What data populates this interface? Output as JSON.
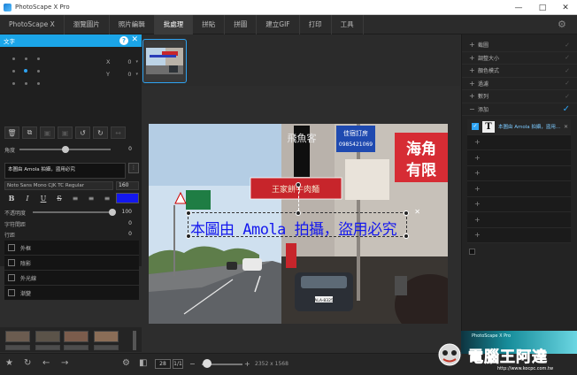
{
  "window": {
    "title": "PhotoScape X Pro"
  },
  "menu": [
    {
      "label": "PhotoScape X"
    },
    {
      "label": "瀏覽圖片"
    },
    {
      "label": "照片編輯"
    },
    {
      "label": "批處理"
    },
    {
      "label": "拼貼"
    },
    {
      "label": "拼圖"
    },
    {
      "label": "建立GIF"
    },
    {
      "label": "打印"
    },
    {
      "label": "工具"
    }
  ],
  "active_menu": "批處理",
  "left_panel": {
    "title": "文字",
    "x_label": "X",
    "x_value": "0",
    "y_label": "Y",
    "y_value": "0",
    "angle_label": "角度",
    "angle_value": "0",
    "angle_fraction": 0.5,
    "text_value": "本圖由 Amola 拍攝，盜用必究",
    "font": "Noto Sans Mono CJK TC Regular",
    "font_size": "160",
    "text_color": "#1418ee",
    "opacity_label": "不透明度",
    "opacity_value": "100",
    "opacity_fraction": 1.0,
    "spacing_label": "字符間距",
    "spacing_value": "0",
    "line_label": "行距",
    "line_value": "0",
    "style_buttons": [
      "B",
      "I",
      "U",
      "S",
      "≡",
      "≡",
      "≡"
    ],
    "effects": [
      {
        "label": "外框"
      },
      {
        "label": "陰影"
      },
      {
        "label": "外光線"
      },
      {
        "label": "漸變"
      }
    ]
  },
  "right_panel": {
    "items": [
      {
        "label": "截圖"
      },
      {
        "label": "調整大小"
      },
      {
        "label": "顏色模式"
      },
      {
        "label": "過濾"
      },
      {
        "label": "數列"
      },
      {
        "label": "添加"
      }
    ],
    "layer_text": "本圖由 Amola 拍攝，盜用..."
  },
  "canvas": {
    "overlay_text": "本圖由 Amola 拍攝，盜用必究",
    "signs": {
      "top_right": "佳宿訂房",
      "phone": "0985421069",
      "red_banner": "王家餅牛肉麵",
      "vertical_left": "飛魚客",
      "hai": "海角",
      "you": "有限",
      "plate": "ALA-8325"
    }
  },
  "statusbar": {
    "counter": "28",
    "counter_total": "1/1",
    "resolution": "2352 x 1568"
  },
  "promo": {
    "title": "PhotoScape X Pro"
  },
  "watermark": {
    "text": "電腦王阿達",
    "url": "http://www.kocpc.com.tw"
  }
}
